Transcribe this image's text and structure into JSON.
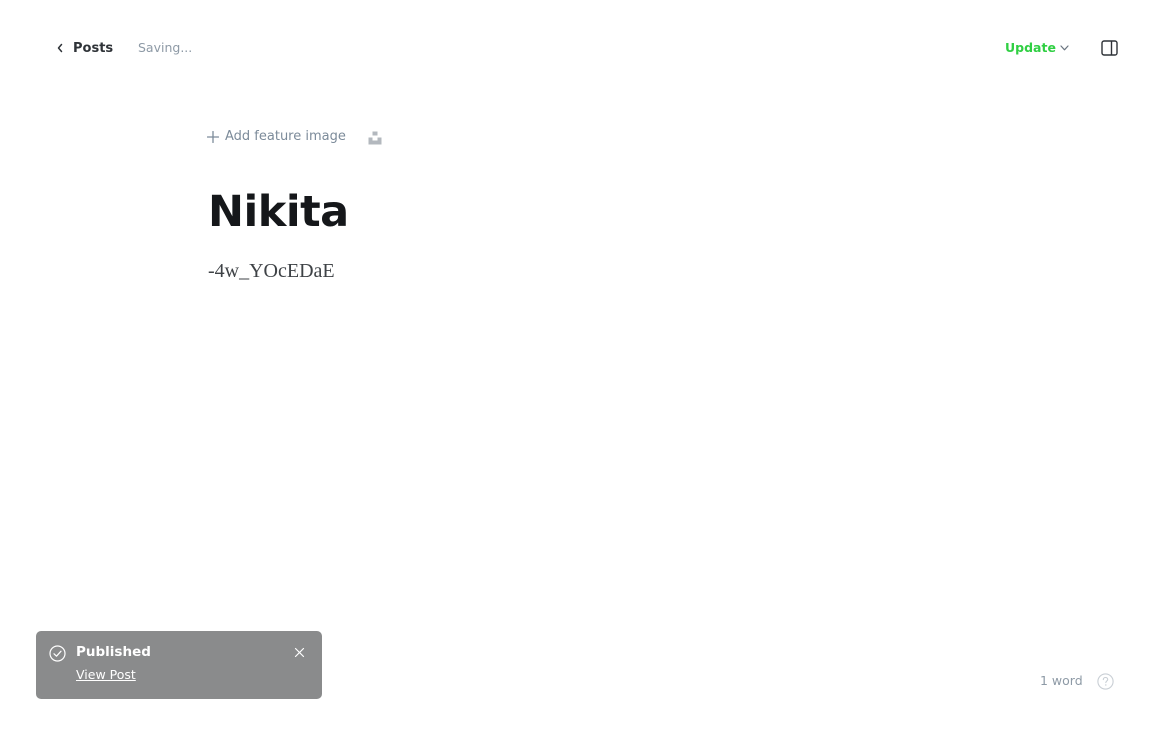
{
  "header": {
    "back_label": "Posts",
    "status_text": "Saving...",
    "update_label": "Update"
  },
  "editor": {
    "feature_image_label": "Add feature image",
    "title": "Nikita",
    "body": "-4w_YOcEDaE"
  },
  "toast": {
    "title": "Published",
    "link_label": "View Post"
  },
  "footer": {
    "word_count": "1 word"
  },
  "colors": {
    "accent_green": "#30cf43",
    "toast_bg": "#8a8b8c",
    "muted_text": "#8e9aa6"
  },
  "icons": [
    "chevron-left-icon",
    "chevron-down-icon",
    "sidebar-toggle-icon",
    "plus-icon",
    "unsplash-icon",
    "check-circle-icon",
    "close-icon",
    "help-icon"
  ]
}
